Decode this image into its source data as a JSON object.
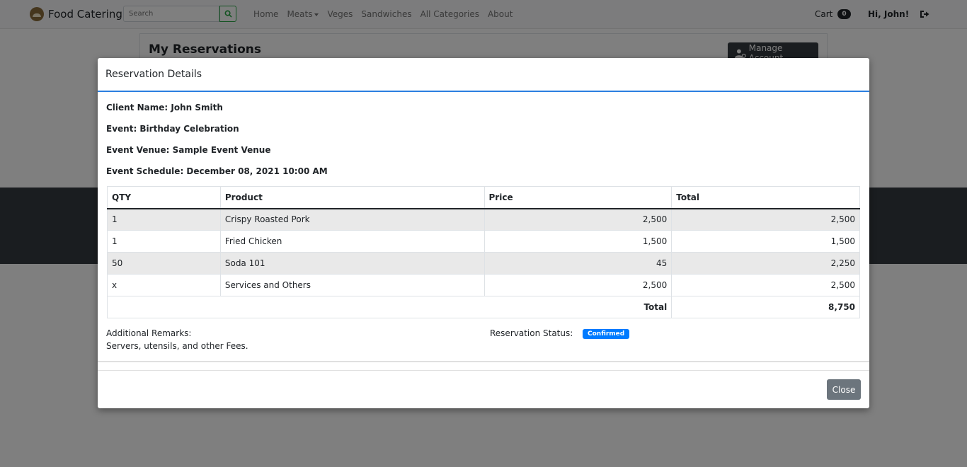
{
  "navbar": {
    "brand": "Food Catering",
    "search_placeholder": "Search",
    "links": [
      "Home",
      "Meats",
      "Veges",
      "Sandwiches",
      "All Categories",
      "About"
    ],
    "cart_label": "Cart",
    "cart_count": "0",
    "greeting": "Hi, John!"
  },
  "page": {
    "title": "My Reservations",
    "manage_account": "Manage Account"
  },
  "modal": {
    "title": "Reservation Details",
    "client_name": "Client Name: John Smith",
    "event": "Event: Birthday Celebration",
    "venue": "Event Venue: Sample Event Venue",
    "schedule": "Event Schedule: December 08, 2021 10:00 AM",
    "table": {
      "headers": [
        "QTY",
        "Product",
        "Price",
        "Total"
      ],
      "rows": [
        [
          "1",
          "Crispy Roasted Pork",
          "2,500",
          "2,500"
        ],
        [
          "1",
          "Fried Chicken",
          "1,500",
          "1,500"
        ],
        [
          "50",
          "Soda 101",
          "45",
          "2,250"
        ],
        [
          "x",
          "Services and Others",
          "2,500",
          "2,500"
        ]
      ],
      "total_label": "Total",
      "total_value": "8,750"
    },
    "remarks_label": "Additional Remarks:",
    "remarks_text": "Servers, utensils, and other Fees.",
    "status_label": "Reservation Status:",
    "status_value": "Confirmed",
    "close_label": "Close"
  },
  "colors": {
    "accent": "#2b7fe0",
    "badge": "#007bff",
    "close_button": "#6c757d",
    "dark": "#343a40"
  }
}
